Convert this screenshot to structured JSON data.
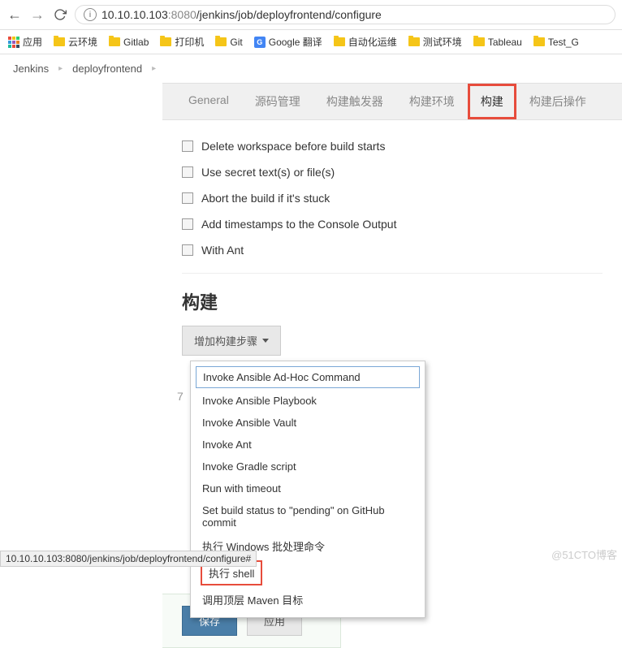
{
  "browser": {
    "url_host": "10.10.10.103",
    "url_port": ":8080",
    "url_path": "/jenkins/job/deployfrontend/configure"
  },
  "bookmarks": {
    "apps": "应用",
    "items": [
      "云环境",
      "Gitlab",
      "打印机",
      "Git",
      "Google 翻译",
      "自动化运维",
      "测试环境",
      "Tableau",
      "Test_G"
    ]
  },
  "breadcrumbs": [
    "Jenkins",
    "deployfrontend"
  ],
  "tabs": [
    "General",
    "源码管理",
    "构建触发器",
    "构建环境",
    "构建",
    "构建后操作"
  ],
  "options": [
    "Delete workspace before build starts",
    "Use secret text(s) or file(s)",
    "Abort the build if it's stuck",
    "Add timestamps to the Console Output",
    "With Ant"
  ],
  "section_title": "构建",
  "add_step_label": "增加构建步骤",
  "dropdown": [
    "Invoke Ansible Ad-Hoc Command",
    "Invoke Ansible Playbook",
    "Invoke Ansible Vault",
    "Invoke Ant",
    "Invoke Gradle script",
    "Run with timeout",
    "Set build status to \"pending\" on GitHub commit",
    "执行 Windows 批处理命令",
    "执行 shell",
    "调用顶层 Maven 目标"
  ],
  "buttons": {
    "save": "保存",
    "apply": "应用"
  },
  "status_bar": "10.10.10.103:8080/jenkins/job/deployfrontend/configure#",
  "watermark": "@51CTO博客",
  "behind_char": "7"
}
